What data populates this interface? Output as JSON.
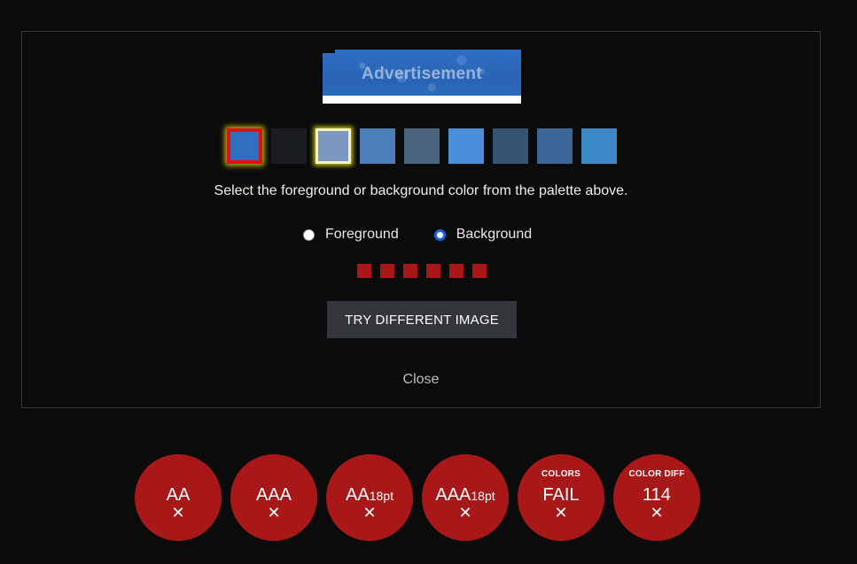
{
  "ad": {
    "label": "Advertisement"
  },
  "palette": {
    "swatches": [
      {
        "color": "#2f6fbd",
        "state": "selected-background"
      },
      {
        "color": "#1a1d22",
        "state": "normal"
      },
      {
        "color": "#7d98be",
        "state": "selected-foreground"
      },
      {
        "color": "#4b7fb9",
        "state": "normal"
      },
      {
        "color": "#4b6580",
        "state": "normal"
      },
      {
        "color": "#4a8fdb",
        "state": "normal"
      },
      {
        "color": "#36536f",
        "state": "normal"
      },
      {
        "color": "#3b6798",
        "state": "normal"
      },
      {
        "color": "#3d88c9",
        "state": "normal"
      }
    ]
  },
  "instructions": "Select the foreground or background color from the palette above.",
  "radio": {
    "foreground_label": "Foreground",
    "background_label": "Background",
    "selected": "background"
  },
  "indicator_count": 6,
  "buttons": {
    "try_different": "TRY DIFFERENT IMAGE",
    "close": "Close"
  },
  "results": [
    {
      "top": "",
      "main": "AA",
      "sub": "",
      "mark": "✕"
    },
    {
      "top": "",
      "main": "AAA",
      "sub": "",
      "mark": "✕"
    },
    {
      "top": "",
      "main": "AA",
      "sub": "18pt",
      "mark": "✕"
    },
    {
      "top": "",
      "main": "AAA",
      "sub": "18pt",
      "mark": "✕"
    },
    {
      "top": "COLORS",
      "main": "FAIL",
      "sub": "",
      "mark": "✕"
    },
    {
      "top": "COLOR DIFF",
      "main": "114",
      "sub": "",
      "mark": "✕"
    }
  ],
  "colors": {
    "fail_red": "#a81818",
    "radio_accent": "#1667d9",
    "button_bg": "#33363b"
  }
}
